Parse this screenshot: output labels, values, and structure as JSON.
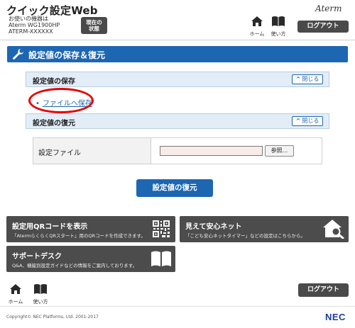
{
  "header": {
    "app_title": "クイック設定Web",
    "device_label": "お使いの機器は",
    "device_model": "Aterm WG1900HP",
    "device_id": "ATERM-XXXXXX",
    "status_button": "現在の\n状態",
    "brand": "Aterm",
    "nav_home": "ホーム",
    "nav_manual": "使い方",
    "logout": "ログアウト"
  },
  "page": {
    "title": "設定値の保存＆復元"
  },
  "save_section": {
    "title": "設定値の保存",
    "close": "閉じる",
    "link": "ファイルへ保存"
  },
  "restore_section": {
    "title": "設定値の復元",
    "close": "閉じる",
    "file_label": "設定ファイル",
    "file_value": "",
    "browse": "参照...",
    "restore_button": "設定値の復元"
  },
  "tiles": {
    "qr": {
      "title": "設定用QRコードを表示",
      "desc": "「AtermらくらくQRスタート」用のQRコードを作成できます。"
    },
    "safety": {
      "title": "見えて安心ネット",
      "desc": "「こども安心ネットタイマー」などの設定はこちらから。"
    },
    "support": {
      "title": "サポートデスク",
      "desc": "Q&A、機能別設定ガイドなどの情報をご案内しております。"
    }
  },
  "footer": {
    "nav_home": "ホーム",
    "nav_manual": "使い方",
    "logout": "ログアウト",
    "copyright": "Copyright© NEC Platforms, Ltd. 2001-2017",
    "nec": "NEC"
  },
  "colors": {
    "accent": "#1d66b2",
    "tile_bg": "#4c4c4c",
    "highlight_ellipse": "#e60000"
  }
}
